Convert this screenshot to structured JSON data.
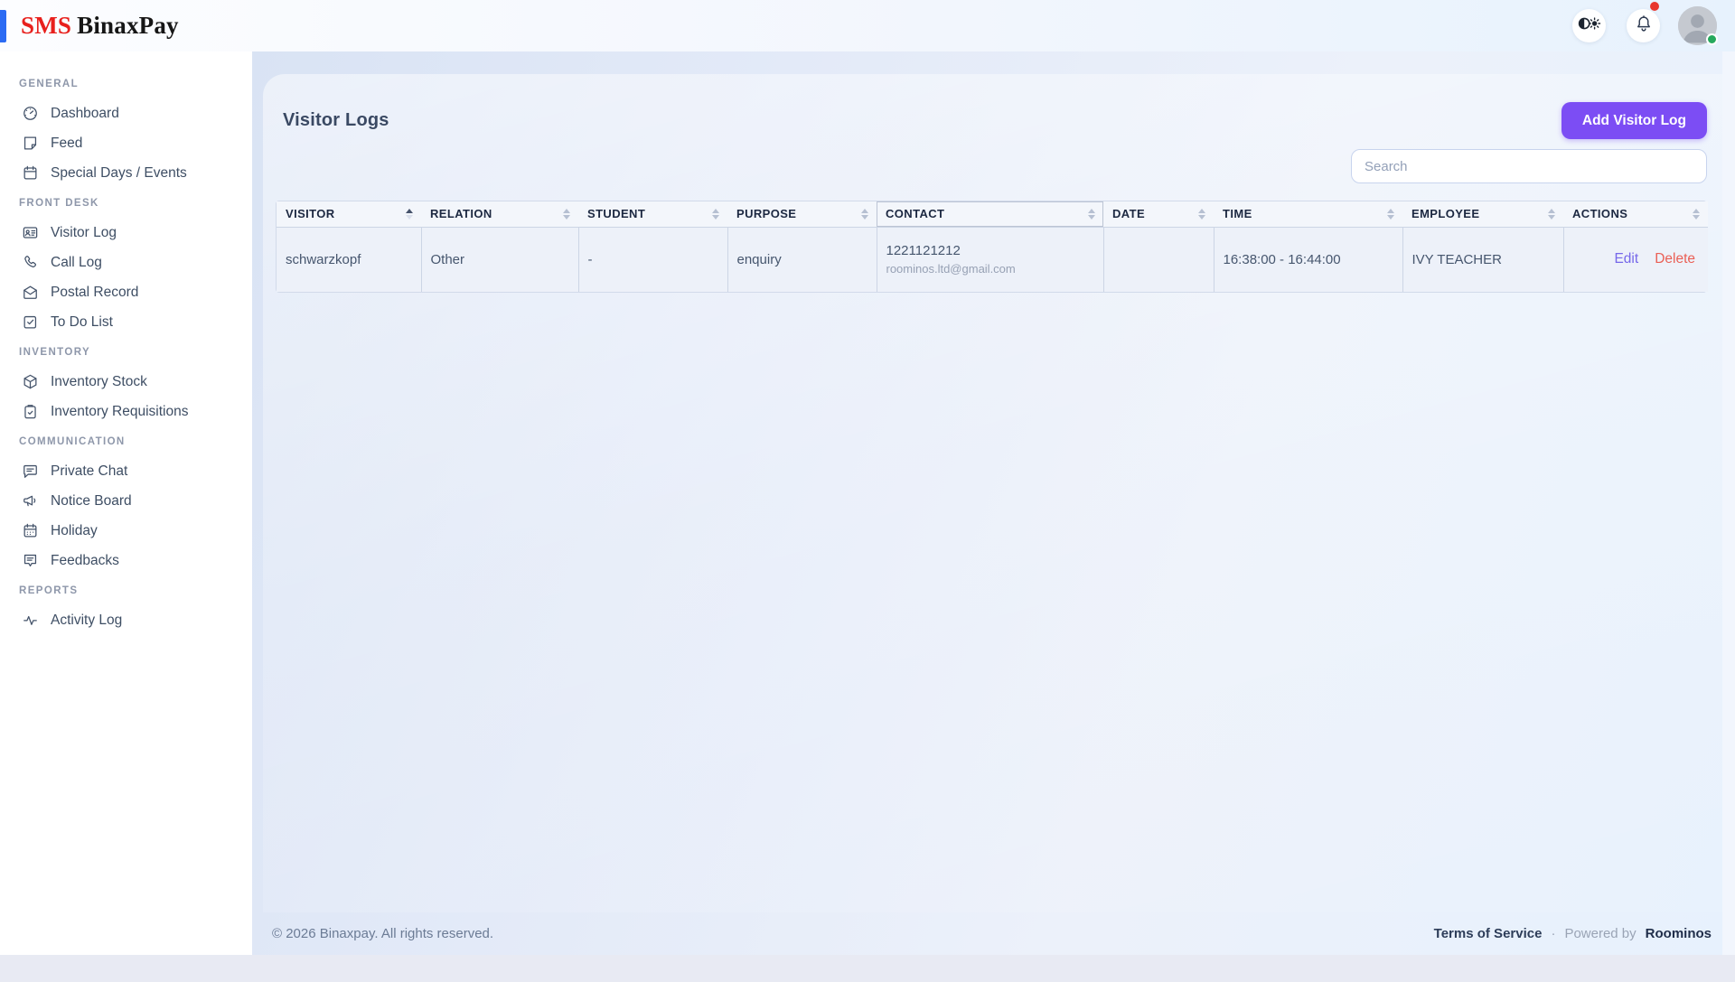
{
  "brand": {
    "prefix": "SMS",
    "name": "BinaxPay"
  },
  "topbar": {
    "icons": [
      "theme-toggle-icon",
      "bell-icon"
    ],
    "notification_badge_color": "#e8362d",
    "avatar_status_color": "#26a95d"
  },
  "page": {
    "title": "Visitor Logs",
    "add_button": "Add Visitor Log",
    "search_placeholder": "Search"
  },
  "sidebar": {
    "sections": [
      {
        "label": "GENERAL",
        "items": [
          {
            "label": "Dashboard",
            "icon": "dashboard"
          },
          {
            "label": "Feed",
            "icon": "feed"
          },
          {
            "label": "Special Days / Events",
            "icon": "calendar"
          }
        ]
      },
      {
        "label": "FRONT DESK",
        "items": [
          {
            "label": "Visitor Log",
            "icon": "id-card"
          },
          {
            "label": "Call Log",
            "icon": "phone"
          },
          {
            "label": "Postal Record",
            "icon": "mail"
          },
          {
            "label": "To Do List",
            "icon": "check-square"
          }
        ]
      },
      {
        "label": "INVENTORY",
        "items": [
          {
            "label": "Inventory Stock",
            "icon": "box"
          },
          {
            "label": "Inventory Requisitions",
            "icon": "clipboard"
          }
        ]
      },
      {
        "label": "COMMUNICATION",
        "items": [
          {
            "label": "Private Chat",
            "icon": "chat"
          },
          {
            "label": "Notice Board",
            "icon": "megaphone"
          },
          {
            "label": "Holiday",
            "icon": "calendar-event"
          },
          {
            "label": "Feedbacks",
            "icon": "feedback"
          }
        ]
      },
      {
        "label": "REPORTS",
        "items": [
          {
            "label": "Activity Log",
            "icon": "activity"
          }
        ]
      }
    ]
  },
  "table": {
    "columns": [
      {
        "key": "visitor",
        "label": "VISITOR",
        "sort": "asc",
        "highlighted": false
      },
      {
        "key": "relation",
        "label": "RELATION",
        "sort": "none",
        "highlighted": false
      },
      {
        "key": "student",
        "label": "STUDENT",
        "sort": "none",
        "highlighted": false
      },
      {
        "key": "purpose",
        "label": "PURPOSE",
        "sort": "none",
        "highlighted": false
      },
      {
        "key": "contact",
        "label": "CONTACT",
        "sort": "none",
        "highlighted": true
      },
      {
        "key": "date",
        "label": "DATE",
        "sort": "none",
        "highlighted": false
      },
      {
        "key": "time",
        "label": "TIME",
        "sort": "none",
        "highlighted": false
      },
      {
        "key": "employee",
        "label": "EMPLOYEE",
        "sort": "none",
        "highlighted": false
      },
      {
        "key": "actions",
        "label": "ACTIONS",
        "sort": "none",
        "highlighted": false
      }
    ],
    "rows": [
      {
        "visitor": "schwarzkopf",
        "relation": "Other",
        "student": "-",
        "purpose": "enquiry",
        "contact": {
          "phone": "1221121212",
          "email": "roominos.ltd@gmail.com"
        },
        "date": "",
        "time": "16:38:00 - 16:44:00",
        "employee": "IVY TEACHER",
        "actions": [
          {
            "type": "edit",
            "label": "Edit"
          },
          {
            "type": "delete",
            "label": "Delete"
          }
        ]
      }
    ]
  },
  "footer": {
    "copyright": "© 2026 Binaxpay. All rights reserved.",
    "terms": "Terms of Service",
    "separator": "·",
    "powered_by": "Powered by",
    "brand": "Roominos"
  },
  "colors": {
    "accent_purple": "#7c4df4",
    "edit_link": "#7668ea",
    "delete_link": "#ea5f55",
    "brand_red": "#e8201d",
    "brand_bar_blue": "#2b6bf3",
    "badge_red": "#e8362d",
    "online_green": "#26a95d"
  }
}
